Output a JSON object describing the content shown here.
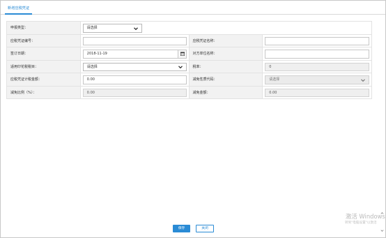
{
  "tab": {
    "label": "新增应税凭证"
  },
  "form": {
    "declare_type": {
      "label": "申报类型：",
      "value": "请选择"
    },
    "voucher_no": {
      "label": "应税凭证编号：",
      "value": ""
    },
    "voucher_name": {
      "label": "应税凭证名称：",
      "value": ""
    },
    "sign_date": {
      "label": "签订日期：",
      "value": "2018-11-19"
    },
    "counterparty": {
      "label": "对方单位名称：",
      "value": ""
    },
    "stamp_item": {
      "label": "适用印花税税目：",
      "value": "请选择"
    },
    "tax_rate": {
      "label": "税率：",
      "value": "0"
    },
    "amount": {
      "label": "应税凭证计税金额：",
      "value": "0.00"
    },
    "relief_code": {
      "label": "减免性质代码：",
      "value": "请选择"
    },
    "relief_ratio": {
      "label": "减免比例（%）：",
      "value": "0.00"
    },
    "relief_amount": {
      "label": "减免金额：",
      "value": "0.00"
    }
  },
  "buttons": {
    "save": "保存",
    "close": "关闭"
  },
  "watermark": {
    "line1": "激活 Windows",
    "line2": "转到\"电脑设置\"以激活"
  },
  "icons": {
    "calendar": "calendar-icon",
    "chevron": "chevron-down-icon"
  },
  "colors": {
    "accent": "#2a8bd5",
    "label_bg": "#f2f2f2"
  }
}
